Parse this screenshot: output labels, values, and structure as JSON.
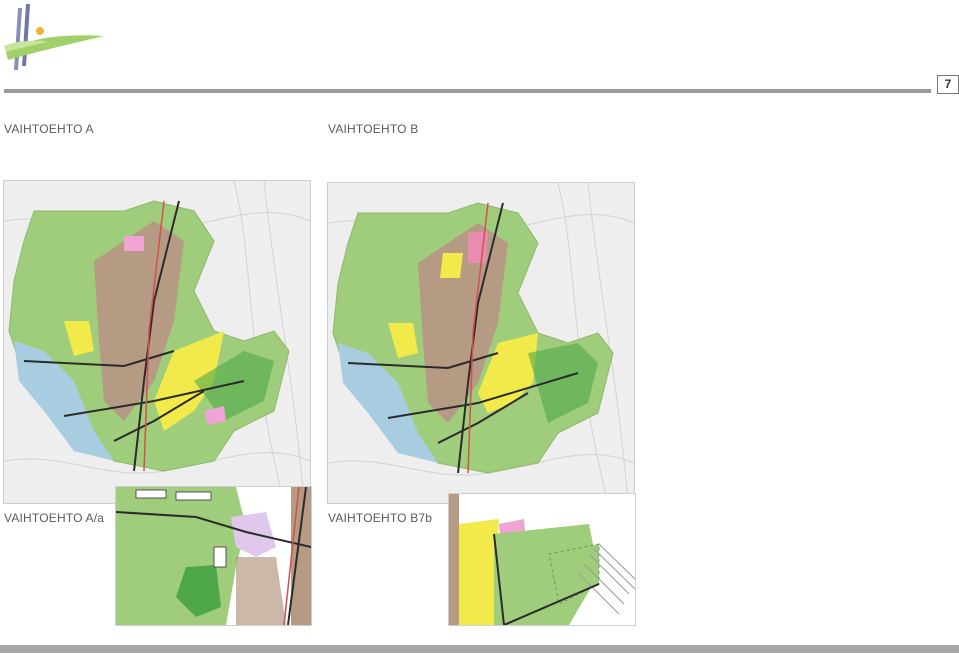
{
  "page": {
    "number": "7"
  },
  "labels": {
    "alt_a": "VAIHTOEHTO A",
    "alt_b": "VAIHTOEHTO B",
    "alt_a_a": "VAIHTOEHTO A/a",
    "alt_b7b": "VAIHTOEHTO B7b"
  },
  "colors": {
    "divider": "#9a9a9a",
    "green_area": "#9fcd7c",
    "dark_green": "#4ea84a",
    "yellow_area": "#f2ea4a",
    "brown_area": "#b59a84",
    "pink_area": "#f0a3d4",
    "water": "#a9cde0",
    "road": "#2b2b2b"
  }
}
